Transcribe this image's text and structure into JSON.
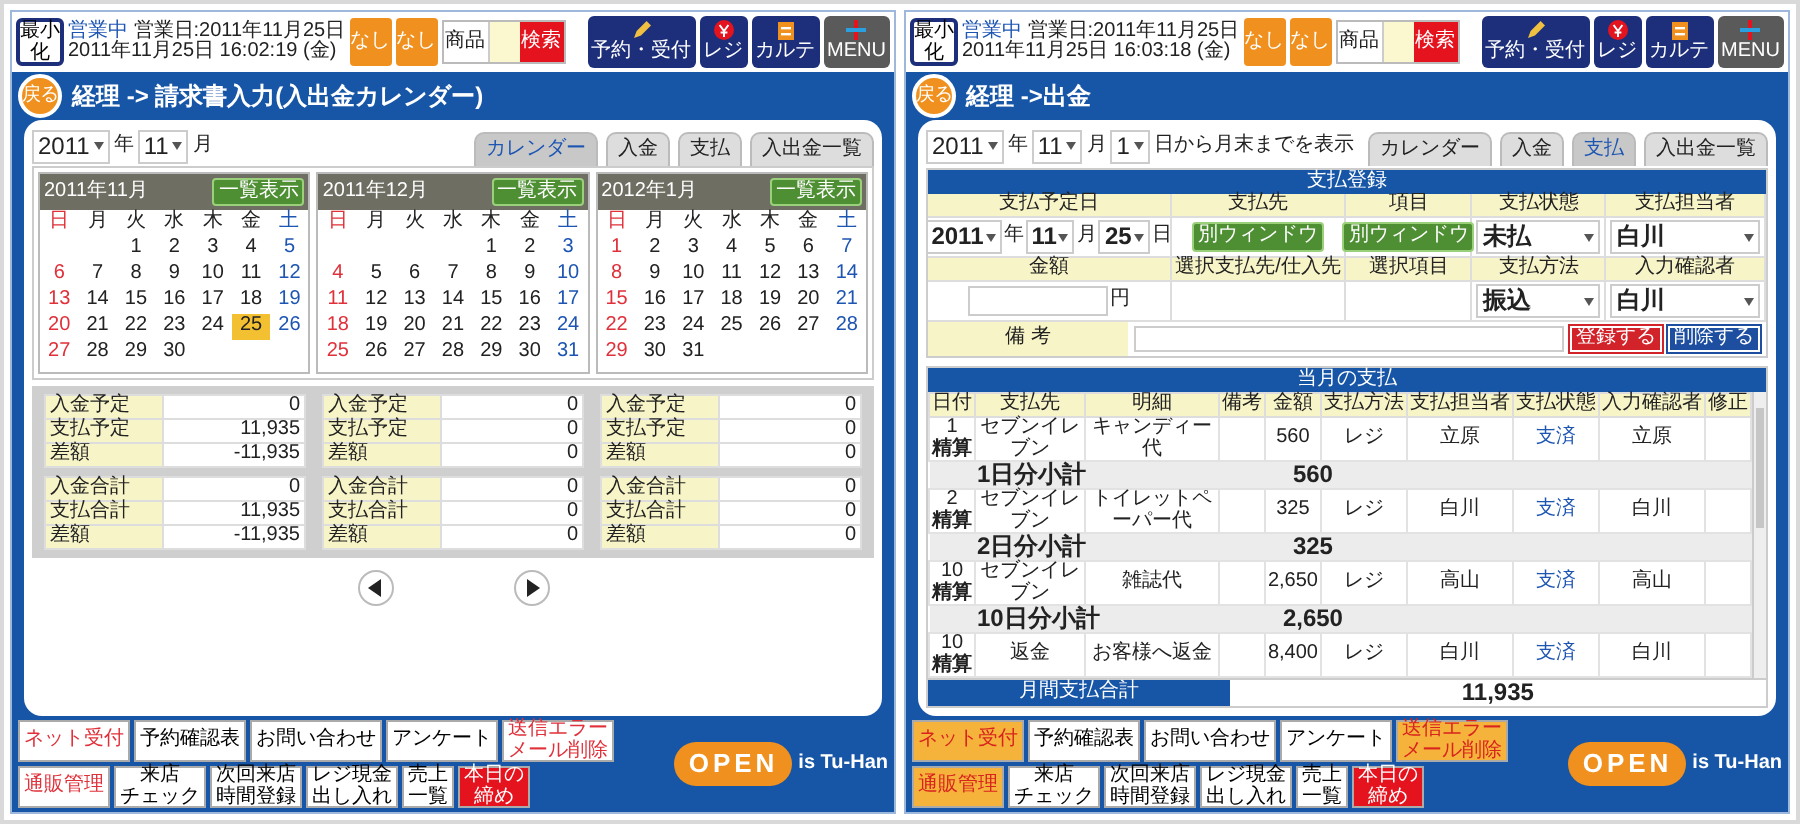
{
  "panels": [
    {
      "kind": "calendar",
      "header": {
        "minimize": "最小化",
        "status": "営業中",
        "business_day": "営業日:2011年11月25日",
        "datetime": "2011年11月25日 16:02:19 (金)",
        "flag_buttons": [
          "なし",
          "なし"
        ],
        "field_label": "商品",
        "field_action": "検索",
        "nav_buttons": [
          "予約・受付",
          "レジ",
          "カルテ",
          "MENU"
        ]
      },
      "title_bar": {
        "back": "戻る",
        "title": "経理 -> 請求書入力(入出金カレンダー)"
      },
      "filters": [
        {
          "value": "2011",
          "unit": "年"
        },
        {
          "value": "11",
          "unit": "月"
        }
      ],
      "tabs": [
        {
          "label": "カレンダー",
          "selected": true
        },
        {
          "label": "入金",
          "selected": false
        },
        {
          "label": "支払",
          "selected": false
        },
        {
          "label": "入出金一覧",
          "selected": false
        }
      ],
      "calendars": [
        {
          "month": "2011年11月",
          "button": "一覧表示",
          "weekdays": [
            "日",
            "月",
            "火",
            "水",
            "木",
            "金",
            "土"
          ],
          "weeks": [
            {
              "tu": "1",
              "we": "2",
              "th": "3",
              "fr": "4",
              "sa": "5"
            },
            {
              "su": "6",
              "mo": "7",
              "tu": "8",
              "we": "9",
              "th": "10",
              "fr": "11",
              "sa": "12"
            },
            {
              "su": "13",
              "mo": "14",
              "tu": "15",
              "we": "16",
              "th": "17",
              "fr": "18",
              "sa": "19"
            },
            {
              "su": "20",
              "mo": "21",
              "tu": "22",
              "we": "23",
              "th": "24",
              "fr": {
                "day": "25",
                "selected": true
              },
              "sa": "26"
            },
            {
              "su": "27",
              "mo": "28",
              "tu": "29",
              "we": "30"
            }
          ]
        },
        {
          "month": "2011年12月",
          "button": "一覧表示",
          "weekdays": [
            "日",
            "月",
            "火",
            "水",
            "木",
            "金",
            "土"
          ],
          "weeks": [
            {
              "th": "1",
              "fr": "2",
              "sa": "3"
            },
            {
              "su": "4",
              "mo": "5",
              "tu": "6",
              "we": "7",
              "th": "8",
              "fr": "9",
              "sa": "10"
            },
            {
              "su": "11",
              "mo": "12",
              "tu": "13",
              "we": "14",
              "th": "15",
              "fr": "16",
              "sa": "17"
            },
            {
              "su": "18",
              "mo": "19",
              "tu": "20",
              "we": "21",
              "th": "22",
              "fr": "23",
              "sa": "24"
            },
            {
              "su": "25",
              "mo": "26",
              "tu": "27",
              "we": "28",
              "th": "29",
              "fr": "30",
              "sa": "31"
            }
          ]
        },
        {
          "month": "2012年1月",
          "button": "一覧表示",
          "weekdays": [
            "日",
            "月",
            "火",
            "水",
            "木",
            "金",
            "土"
          ],
          "weeks": [
            {
              "su": "1",
              "mo": "2",
              "tu": "3",
              "we": "4",
              "th": "5",
              "fr": "6",
              "sa": "7"
            },
            {
              "su": "8",
              "mo": "9",
              "tu": "10",
              "we": "11",
              "th": "12",
              "fr": "13",
              "sa": "14"
            },
            {
              "su": "15",
              "mo": "16",
              "tu": "17",
              "we": "18",
              "th": "19",
              "fr": "20",
              "sa": "21"
            },
            {
              "su": "22",
              "mo": "23",
              "tu": "24",
              "we": "25",
              "th": "26",
              "fr": "27",
              "sa": "28"
            },
            {
              "su": "29",
              "mo": "30",
              "tu": "31"
            }
          ]
        }
      ],
      "summaries": [
        {
          "groups": [
            [
              {
                "label": "入金予定",
                "value": "0"
              },
              {
                "label": "支払予定",
                "value": "11,935"
              },
              {
                "label": "差額",
                "value": "-11,935"
              }
            ],
            [
              {
                "label": "入金合計",
                "value": "0"
              },
              {
                "label": "支払合計",
                "value": "11,935"
              },
              {
                "label": "差額",
                "value": "-11,935"
              }
            ]
          ]
        },
        {
          "groups": [
            [
              {
                "label": "入金予定",
                "value": "0"
              },
              {
                "label": "支払予定",
                "value": "0"
              },
              {
                "label": "差額",
                "value": "0"
              }
            ],
            [
              {
                "label": "入金合計",
                "value": "0"
              },
              {
                "label": "支払合計",
                "value": "0"
              },
              {
                "label": "差額",
                "value": "0"
              }
            ]
          ]
        },
        {
          "groups": [
            [
              {
                "label": "入金予定",
                "value": "0"
              },
              {
                "label": "支払予定",
                "value": "0"
              },
              {
                "label": "差額",
                "value": "0"
              }
            ],
            [
              {
                "label": "入金合計",
                "value": "0"
              },
              {
                "label": "支払合計",
                "value": "0"
              },
              {
                "label": "差額",
                "value": "0"
              }
            ]
          ]
        }
      ],
      "footer": {
        "buttons": [
          {
            "lines": [
              "ネット受付"
            ],
            "kind": "alert"
          },
          {
            "lines": [
              "予約確認表"
            ],
            "kind": "plain"
          },
          {
            "lines": [
              "お問い合わせ"
            ],
            "kind": "plain"
          },
          {
            "lines": [
              "アンケート"
            ],
            "kind": "plain"
          },
          {
            "lines": [
              "送信エラー",
              "メール削除"
            ],
            "kind": "alert"
          },
          {
            "lines": [
              "通販管理"
            ],
            "kind": "alert"
          },
          {
            "lines": [
              "来店",
              "チェック"
            ],
            "kind": "plain"
          },
          {
            "lines": [
              "次回来店",
              "時間登録"
            ],
            "kind": "plain"
          },
          {
            "lines": [
              "レジ現金",
              "出し入れ"
            ],
            "kind": "plain"
          },
          {
            "lines": [
              "売上",
              "一覧"
            ],
            "kind": "plain"
          },
          {
            "lines": [
              "本日の",
              "締め"
            ],
            "kind": "danger"
          }
        ],
        "open": "OPEN",
        "brand": "is Tu-Han"
      }
    },
    {
      "kind": "payment",
      "header": {
        "minimize": "最小化",
        "status": "営業中",
        "business_day": "営業日:2011年11月25日",
        "datetime": "2011年11月25日 16:03:18 (金)",
        "flag_buttons": [
          "なし",
          "なし"
        ],
        "field_label": "商品",
        "field_action": "検索",
        "nav_buttons": [
          "予約・受付",
          "レジ",
          "カルテ",
          "MENU"
        ]
      },
      "title_bar": {
        "back": "戻る",
        "title": "経理 ->出金"
      },
      "filters": [
        {
          "value": "2011",
          "unit": "年"
        },
        {
          "value": "11",
          "unit": "月"
        },
        {
          "value": "1",
          "unit": "日から月末までを表示"
        }
      ],
      "tabs": [
        {
          "label": "カレンダー",
          "selected": false
        },
        {
          "label": "入金",
          "selected": false
        },
        {
          "label": "支払",
          "selected": true
        },
        {
          "label": "入出金一覧",
          "selected": false
        }
      ],
      "form": {
        "title": "支払登録",
        "header1": [
          "支払予定日",
          "支払先",
          "項目",
          "支払状態",
          "支払担当者"
        ],
        "date": [
          {
            "value": "2011",
            "unit": "年"
          },
          {
            "value": "11",
            "unit": "月"
          },
          {
            "value": "25",
            "unit": "日"
          }
        ],
        "picker_buttons": [
          "別ウィンドウ",
          "別ウィンドウ"
        ],
        "status_select": "未払",
        "staff_select": "白川",
        "header2": [
          "金額",
          "選択支払先/仕入先",
          "選択項目",
          "支払方法",
          "入力確認者"
        ],
        "amount_unit": "円",
        "method_select": "振込",
        "checker_select": "白川",
        "note_label": "備 考",
        "save": "登録する",
        "delete": "削除する"
      },
      "list": {
        "title": "当月の支払",
        "columns": [
          "日付",
          "支払先",
          "明細",
          "備考",
          "金額",
          "支払方法",
          "支払担当者",
          "支払状態",
          "入力確認者",
          "修正"
        ],
        "rows": [
          {
            "kind": "entry",
            "day": "1",
            "day_note": "精算",
            "payee": "セブンイレブン",
            "detail": "キャンディー代",
            "amount": "560",
            "method": "レジ",
            "staff": "立原",
            "status": "支済",
            "checker": "立原"
          },
          {
            "kind": "subtotal",
            "label": "1日分小計",
            "amount": "560"
          },
          {
            "kind": "entry",
            "day": "2",
            "day_note": "精算",
            "payee": "セブンイレブン",
            "detail": "トイレットペーパー代",
            "amount": "325",
            "method": "レジ",
            "staff": "白川",
            "status": "支済",
            "checker": "白川"
          },
          {
            "kind": "subtotal",
            "label": "2日分小計",
            "amount": "325"
          },
          {
            "kind": "entry",
            "day": "10",
            "day_note": "精算",
            "payee": "セブンイレブン",
            "detail": "雑誌代",
            "amount": "2,650",
            "method": "レジ",
            "staff": "高山",
            "status": "支済",
            "checker": "高山"
          },
          {
            "kind": "subtotal",
            "label": "10日分小計",
            "amount": "2,650"
          },
          {
            "kind": "entry",
            "day": "10",
            "day_note": "精算",
            "payee": "返金",
            "detail": "お客様へ返金",
            "amount": "8,400",
            "method": "レジ",
            "staff": "白川",
            "status": "支済",
            "checker": "白川"
          }
        ],
        "total_label": "月間支払合計",
        "total": "11,935"
      },
      "footer": {
        "buttons": [
          {
            "lines": [
              "ネット受付"
            ],
            "kind": "highlight"
          },
          {
            "lines": [
              "予約確認表"
            ],
            "kind": "plain"
          },
          {
            "lines": [
              "お問い合わせ"
            ],
            "kind": "plain"
          },
          {
            "lines": [
              "アンケート"
            ],
            "kind": "plain"
          },
          {
            "lines": [
              "送信エラー",
              "メール削除"
            ],
            "kind": "highlight"
          },
          {
            "lines": [
              "通販管理"
            ],
            "kind": "highlight"
          },
          {
            "lines": [
              "来店",
              "チェック"
            ],
            "kind": "plain"
          },
          {
            "lines": [
              "次回来店",
              "時間登録"
            ],
            "kind": "plain"
          },
          {
            "lines": [
              "レジ現金",
              "出し入れ"
            ],
            "kind": "plain"
          },
          {
            "lines": [
              "売上",
              "一覧"
            ],
            "kind": "plain"
          },
          {
            "lines": [
              "本日の",
              "締め"
            ],
            "kind": "danger"
          }
        ],
        "open": "OPEN",
        "brand": "is Tu-Han"
      }
    }
  ]
}
